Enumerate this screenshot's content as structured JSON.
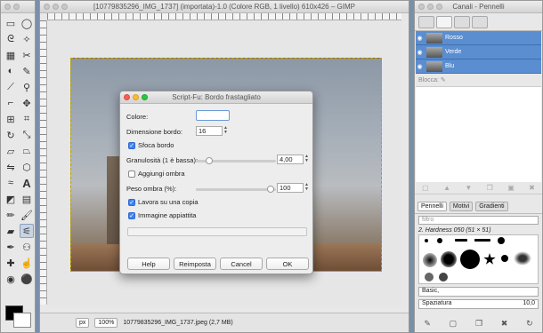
{
  "canvas_window": {
    "title": "[10779835296_IMG_1737] (importata)-1.0 (Colore RGB, 1 livello) 610x426 – GIMP",
    "status_unit": "px",
    "zoom": "100%",
    "status_file": "10779835296_IMG_1737.jpeg (2,7 MB)"
  },
  "panel": {
    "title": "Canali - Pennelli",
    "channels": [
      {
        "label": "Rosso"
      },
      {
        "label": "Verde"
      },
      {
        "label": "Blu"
      }
    ],
    "lock_label": "Blocca:",
    "brush_tabs": [
      "Pennelli",
      "Motivi",
      "Gradienti"
    ],
    "filter_placeholder": "filtro",
    "brush_name": "2. Hardness 050 (51 × 51)",
    "preset": "Basic,",
    "spacing_label": "Spaziatura",
    "spacing_value": "10,0"
  },
  "dialog": {
    "title": "Script-Fu: Bordo frastagliato",
    "color_label": "Colore:",
    "size_label": "Dimensione bordo:",
    "size_value": "16",
    "blur_label": "Sfoca bordo",
    "blur_checked": true,
    "granularity_label": "Granulosità (1 è bassa):",
    "granularity_value": "4,00",
    "shadow_label": "Aggiungi ombra",
    "shadow_checked": false,
    "shadow_weight_label": "Peso ombra (%):",
    "shadow_weight_value": "100",
    "copy_label": "Lavora su una copia",
    "copy_checked": true,
    "flatten_label": "Immagine appiattita",
    "flatten_checked": true,
    "buttons": {
      "help": "Help",
      "reset": "Reimposta",
      "cancel": "Cancel",
      "ok": "OK"
    }
  },
  "colors": {
    "selection": "#5a8ed0",
    "fg": "#000000",
    "bg": "#ffffff"
  }
}
